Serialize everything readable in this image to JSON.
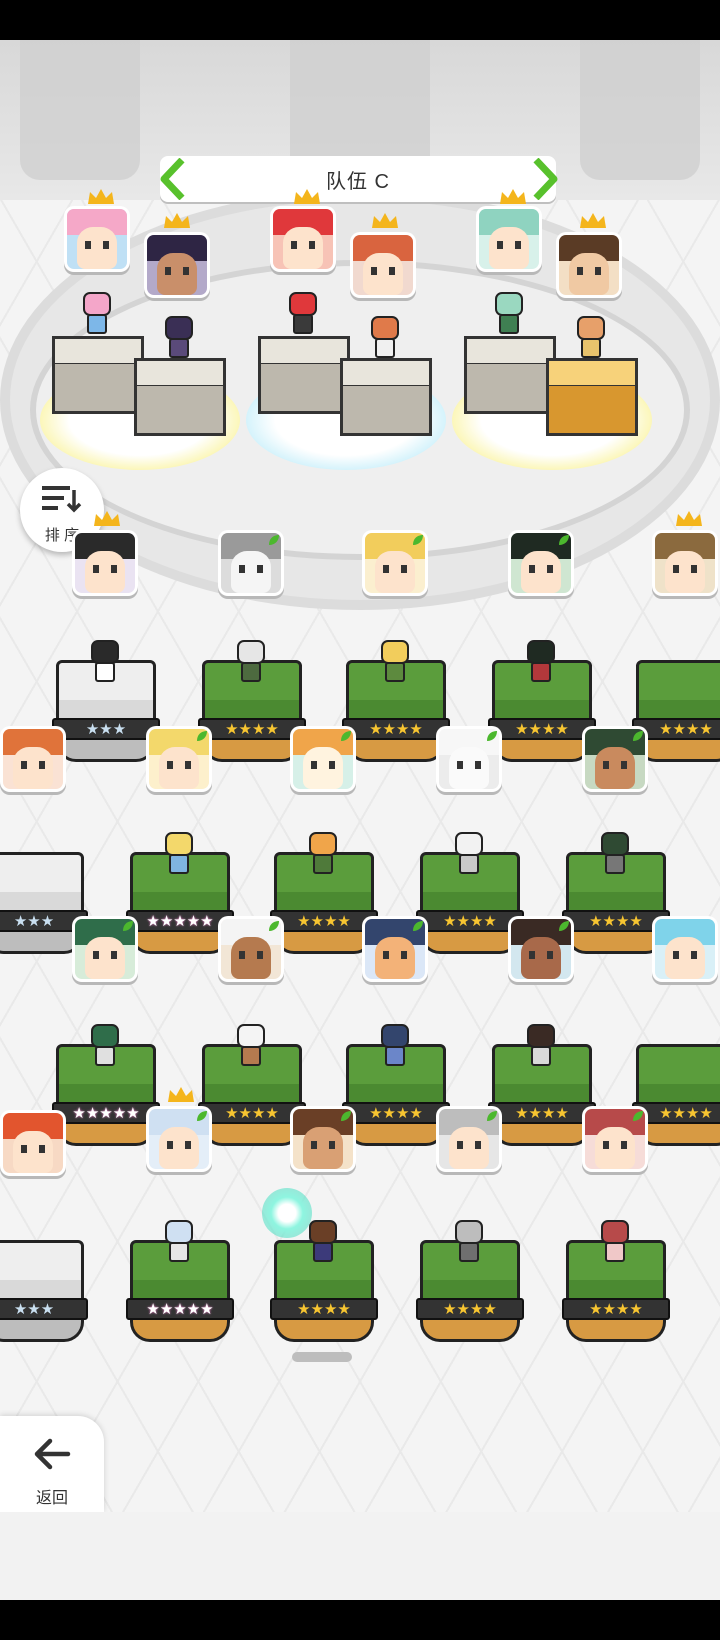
{
  "team": {
    "name": "队伍 C"
  },
  "buttons": {
    "sort_label": "排 序",
    "back_label": "返回"
  },
  "star_ratings": {
    "three": "★★★",
    "four": "★★★★",
    "five": "★★★★★"
  },
  "colors": {
    "banner_arrow": "#58c12c",
    "crown": "#f4b51c",
    "grass": "#5b9d3c",
    "leaf_badge": "#4cb82e"
  },
  "icons": {
    "sort": "sort-descending-icon",
    "back": "arrow-left-icon",
    "crown": "crown-icon",
    "leaf": "leaf-badge-icon"
  }
}
